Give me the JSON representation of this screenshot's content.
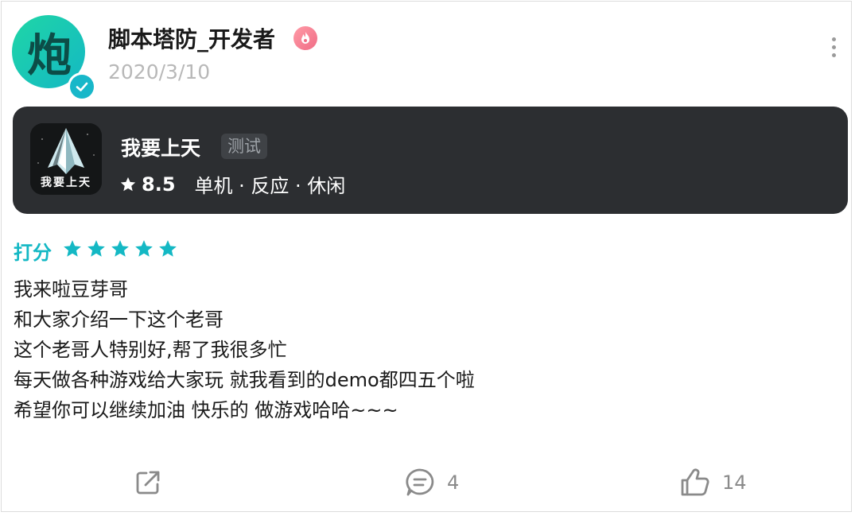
{
  "author": {
    "name": "脚本塔防_开发者",
    "date": "2020/3/10",
    "avatar_icon": "cannon-glyph-icon",
    "avatar_text": "炮",
    "verified_icon": "verified-check-icon",
    "badge_icon": "developer-flame-icon"
  },
  "game": {
    "name": "我要上天",
    "tag": "测试",
    "rating": "8.5",
    "genres": "单机 · 反应 · 休闲",
    "icon_label": "我要上天",
    "icon": "game-rocket-icon"
  },
  "review": {
    "rating_label": "打分",
    "stars": 5,
    "lines": [
      "我来啦豆芽哥",
      "和大家介绍一下这个老哥",
      "这个老哥人特别好,帮了我很多忙",
      "每天做各种游戏给大家玩 就我看到的demo都四五个啦",
      "希望你可以继续加油 快乐的 做游戏哈哈~~~"
    ]
  },
  "actions": {
    "share_icon": "share-icon",
    "comment_icon": "comment-icon",
    "comment_count": "4",
    "like_icon": "thumbs-up-icon",
    "like_count": "14"
  },
  "colors": {
    "accent": "#14b8c4",
    "card_bg": "#2c2e31",
    "muted": "#8a8a8a"
  }
}
